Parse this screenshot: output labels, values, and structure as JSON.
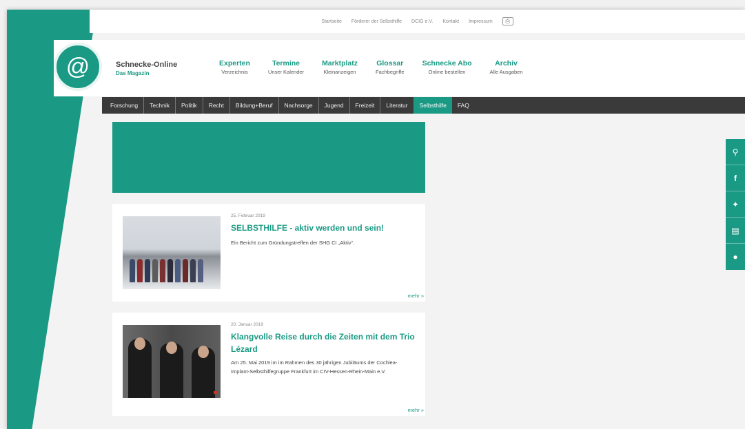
{
  "topbar": {
    "links": [
      "Startseite",
      "Förderer der Selbsthilfe",
      "DCIG e.V.",
      "Kontakt",
      "Impressum"
    ],
    "print_icon": "print-icon"
  },
  "brand": {
    "name": "Schnecke-Online",
    "subtitle": "Das Magazin"
  },
  "mainnav": [
    {
      "title": "Experten",
      "sub": "Verzeichnis"
    },
    {
      "title": "Termine",
      "sub": "Unser Kalender"
    },
    {
      "title": "Marktplatz",
      "sub": "Kleinanzeigen"
    },
    {
      "title": "Glossar",
      "sub": "Fachbegriffe"
    },
    {
      "title": "Schnecke Abo",
      "sub": "Online bestellen"
    },
    {
      "title": "Archiv",
      "sub": "Alle Ausgaben"
    }
  ],
  "categories": [
    "Forschung",
    "Technik",
    "Politik",
    "Recht",
    "Bildung+Beruf",
    "Nachsorge",
    "Jugend",
    "Freizeit",
    "Literatur",
    "Selbsthilfe",
    "FAQ"
  ],
  "active_category": "Selbsthilfe",
  "articles": [
    {
      "date": "25. Februar 2019",
      "title": "SELBSTHILFE - aktiv werden und sein!",
      "excerpt": "Ein Bericht zum Gründungstreffen der SHG CI „Aktiv“.",
      "more": "mehr »"
    },
    {
      "date": "20. Januar 2019",
      "title": "Klangvolle Reise durch die Zeiten mit dem Trio Lézard",
      "excerpt": "Am 25. Mai 2019 im im Rahmen des 30 jährigen Jubiläums der Cochlea- Implant-Selbsthilfegruppe Frankfurt im CIV-Hessen-Rhein-Main e.V.",
      "more": "mehr »"
    }
  ],
  "social": [
    "search-icon",
    "facebook-icon",
    "twitter-icon",
    "newsletter-icon",
    "chat-icon"
  ],
  "colors": {
    "accent": "#1a9a84",
    "dark_nav": "#3a3a3a"
  }
}
